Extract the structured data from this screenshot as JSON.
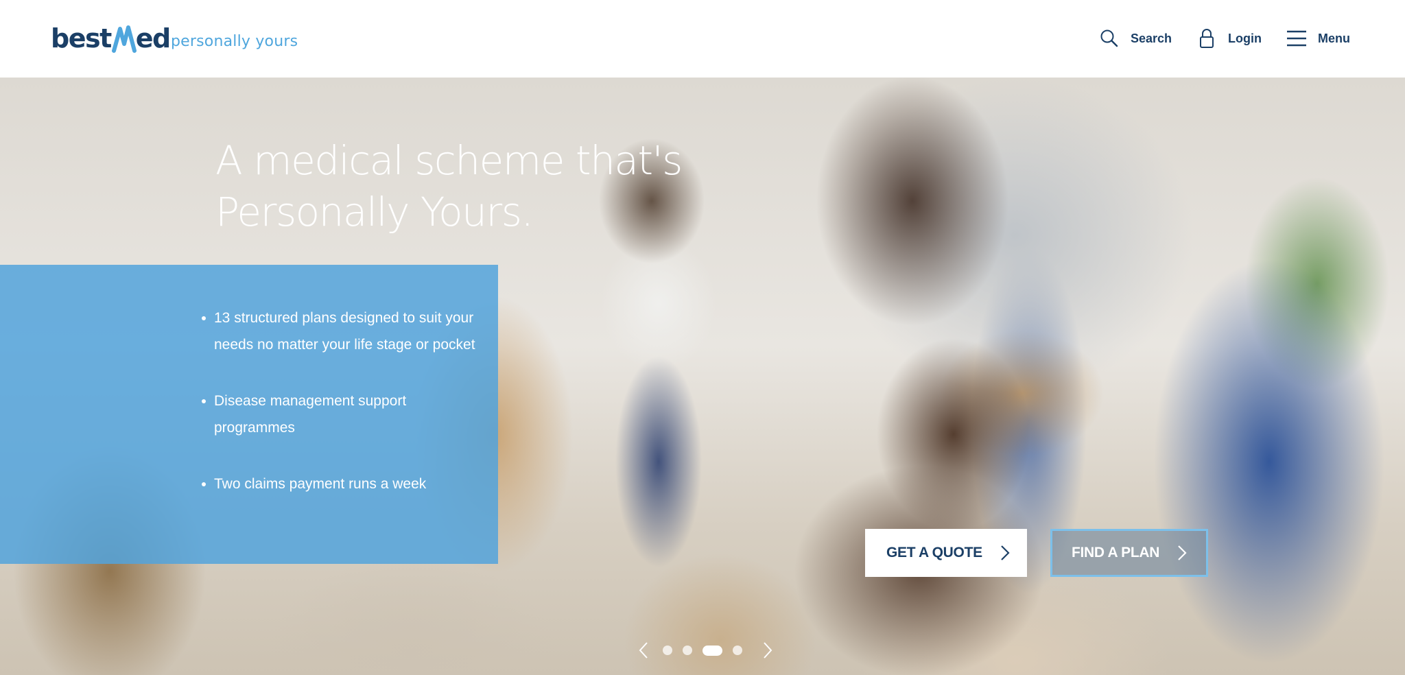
{
  "brand": {
    "logo_prefix": "best",
    "logo_suffix": "ed",
    "tagline": "personally yours",
    "colors": {
      "navy": "#1b3f66",
      "light_blue": "#4fa6dd",
      "panel_blue": "#52a3dc"
    }
  },
  "nav": {
    "items": [
      {
        "label": "Search",
        "icon": "search-icon"
      },
      {
        "label": "Login",
        "icon": "lock-icon"
      },
      {
        "label": "Menu",
        "icon": "hamburger-icon"
      }
    ]
  },
  "hero": {
    "title_line1": "A medical scheme that's",
    "title_line2": "Personally Yours.",
    "benefits": [
      "13 structured plans designed to suit your needs no matter your life stage or pocket",
      "Disease management support programmes",
      "Two claims payment runs a week"
    ],
    "buttons": {
      "quote": "GET A QUOTE",
      "plan": "FIND A PLAN"
    },
    "carousel": {
      "total_slides": 4,
      "active_slide": 3
    }
  }
}
